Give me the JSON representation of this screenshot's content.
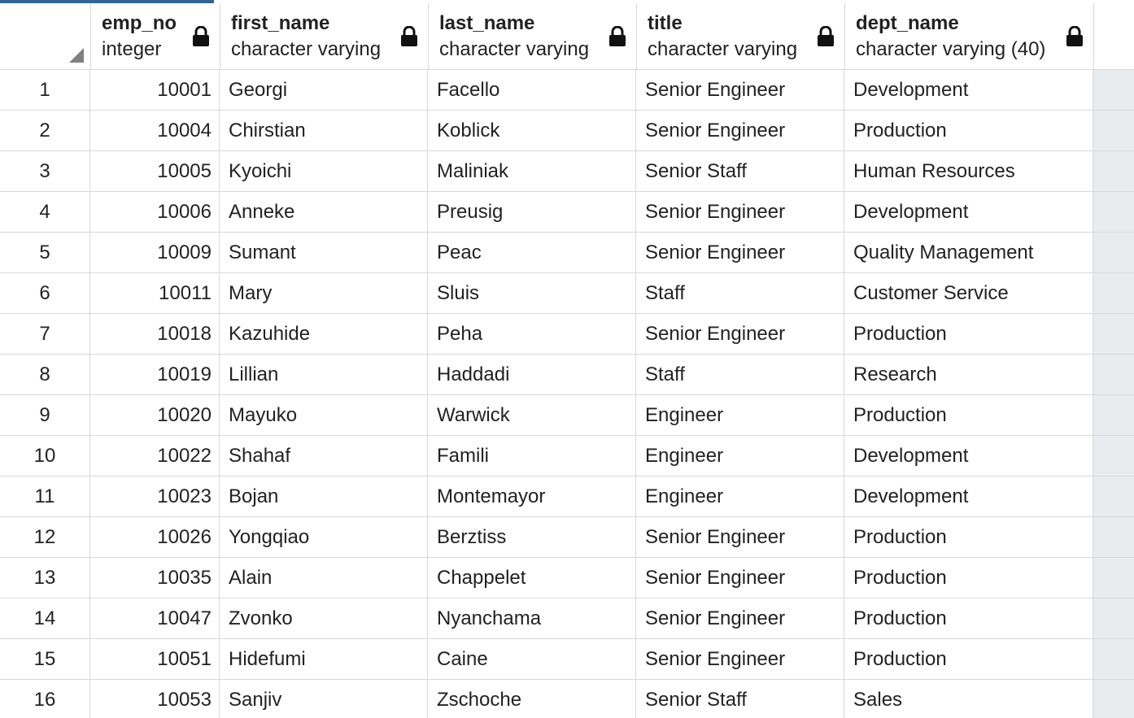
{
  "columns": [
    {
      "name": "emp_no",
      "type": "integer"
    },
    {
      "name": "first_name",
      "type": "character varying"
    },
    {
      "name": "last_name",
      "type": "character varying"
    },
    {
      "name": "title",
      "type": "character varying"
    },
    {
      "name": "dept_name",
      "type": "character varying (40)"
    }
  ],
  "icons": {
    "column_lock": "lock-icon",
    "corner": "select-all-triangle"
  },
  "colors": {
    "accent": "#326690",
    "grid_line": "#d8d8d8",
    "filler": "#e9ecef"
  },
  "rows": [
    {
      "n": "1",
      "emp_no": "10001",
      "first_name": "Georgi",
      "last_name": "Facello",
      "title": "Senior Engineer",
      "dept_name": "Development"
    },
    {
      "n": "2",
      "emp_no": "10004",
      "first_name": "Chirstian",
      "last_name": "Koblick",
      "title": "Senior Engineer",
      "dept_name": "Production"
    },
    {
      "n": "3",
      "emp_no": "10005",
      "first_name": "Kyoichi",
      "last_name": "Maliniak",
      "title": "Senior Staff",
      "dept_name": "Human Resources"
    },
    {
      "n": "4",
      "emp_no": "10006",
      "first_name": "Anneke",
      "last_name": "Preusig",
      "title": "Senior Engineer",
      "dept_name": "Development"
    },
    {
      "n": "5",
      "emp_no": "10009",
      "first_name": "Sumant",
      "last_name": "Peac",
      "title": "Senior Engineer",
      "dept_name": "Quality Management"
    },
    {
      "n": "6",
      "emp_no": "10011",
      "first_name": "Mary",
      "last_name": "Sluis",
      "title": "Staff",
      "dept_name": "Customer Service"
    },
    {
      "n": "7",
      "emp_no": "10018",
      "first_name": "Kazuhide",
      "last_name": "Peha",
      "title": "Senior Engineer",
      "dept_name": "Production"
    },
    {
      "n": "8",
      "emp_no": "10019",
      "first_name": "Lillian",
      "last_name": "Haddadi",
      "title": "Staff",
      "dept_name": "Research"
    },
    {
      "n": "9",
      "emp_no": "10020",
      "first_name": "Mayuko",
      "last_name": "Warwick",
      "title": "Engineer",
      "dept_name": "Production"
    },
    {
      "n": "10",
      "emp_no": "10022",
      "first_name": "Shahaf",
      "last_name": "Famili",
      "title": "Engineer",
      "dept_name": "Development"
    },
    {
      "n": "11",
      "emp_no": "10023",
      "first_name": "Bojan",
      "last_name": "Montemayor",
      "title": "Engineer",
      "dept_name": "Development"
    },
    {
      "n": "12",
      "emp_no": "10026",
      "first_name": "Yongqiao",
      "last_name": "Berztiss",
      "title": "Senior Engineer",
      "dept_name": "Production"
    },
    {
      "n": "13",
      "emp_no": "10035",
      "first_name": "Alain",
      "last_name": "Chappelet",
      "title": "Senior Engineer",
      "dept_name": "Production"
    },
    {
      "n": "14",
      "emp_no": "10047",
      "first_name": "Zvonko",
      "last_name": "Nyanchama",
      "title": "Senior Engineer",
      "dept_name": "Production"
    },
    {
      "n": "15",
      "emp_no": "10051",
      "first_name": "Hidefumi",
      "last_name": "Caine",
      "title": "Senior Engineer",
      "dept_name": "Production"
    },
    {
      "n": "16",
      "emp_no": "10053",
      "first_name": "Sanjiv",
      "last_name": "Zschoche",
      "title": "Senior Staff",
      "dept_name": "Sales"
    }
  ]
}
